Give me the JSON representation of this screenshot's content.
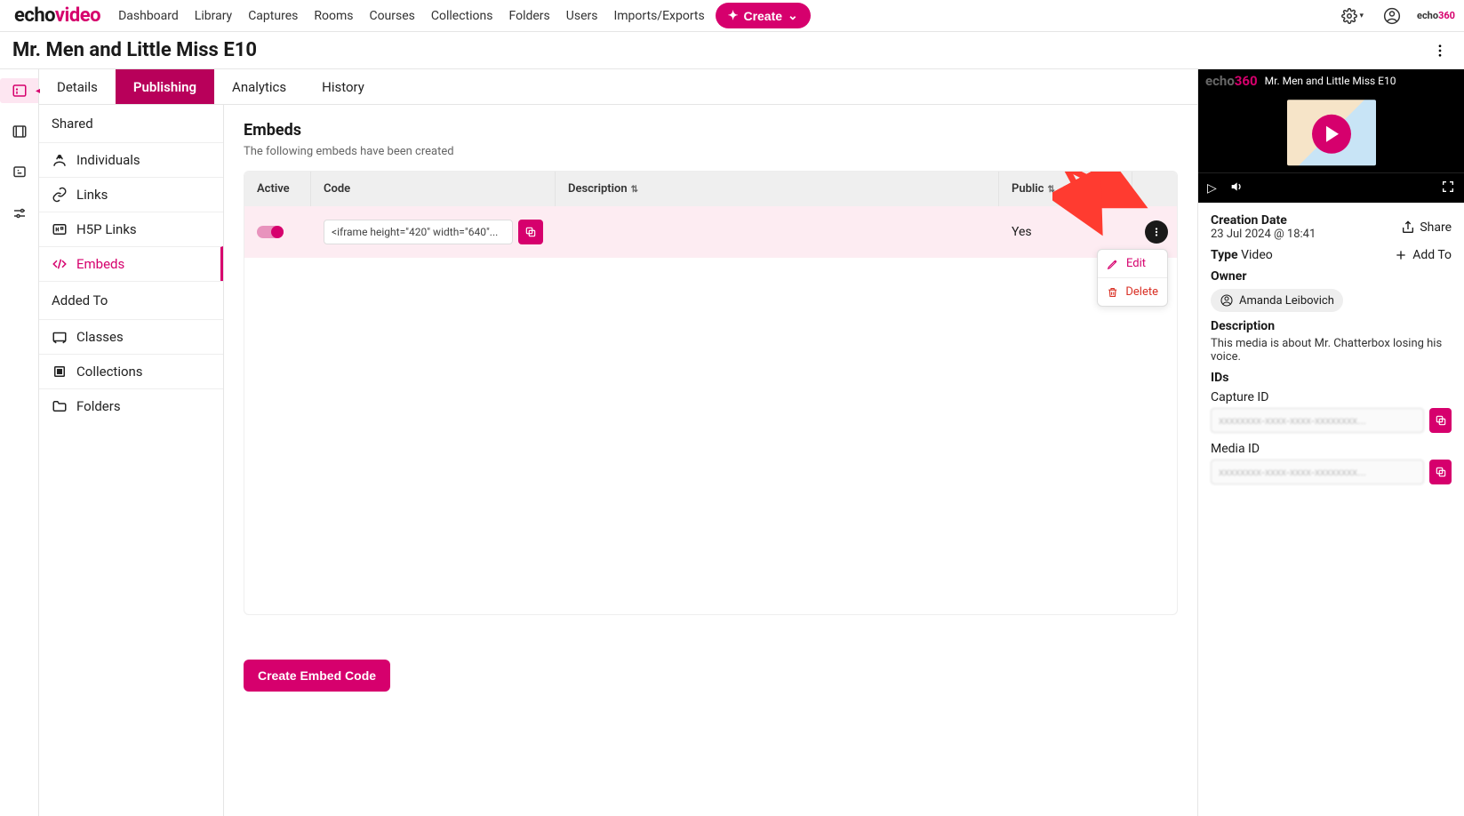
{
  "brand": {
    "part1": "echo",
    "part2": "video"
  },
  "nav": {
    "items": [
      "Dashboard",
      "Library",
      "Captures",
      "Rooms",
      "Courses",
      "Collections",
      "Folders",
      "Users",
      "Imports/Exports"
    ],
    "create": "Create"
  },
  "page": {
    "title": "Mr. Men and Little Miss E10"
  },
  "tabs": [
    "Details",
    "Publishing",
    "Analytics",
    "History"
  ],
  "activeTab": "Publishing",
  "sidemenu": {
    "shared": {
      "title": "Shared",
      "items": [
        "Individuals",
        "Links",
        "H5P Links",
        "Embeds"
      ]
    },
    "added": {
      "title": "Added To",
      "items": [
        "Classes",
        "Collections",
        "Folders"
      ]
    },
    "active": "Embeds"
  },
  "content": {
    "heading": "Embeds",
    "subtitle": "The following embeds have been created",
    "columns": {
      "active": "Active",
      "code": "Code",
      "description": "Description",
      "public": "Public"
    },
    "rows": [
      {
        "active": true,
        "code": "<iframe height=\"420\" width=\"640\"...",
        "description": "",
        "public": "Yes"
      }
    ],
    "dropdown": {
      "edit": "Edit",
      "delete": "Delete"
    },
    "createButton": "Create Embed Code"
  },
  "inspector": {
    "playerTitle": "Mr. Men and Little Miss E10",
    "creationDateLabel": "Creation Date",
    "creationDate": "23 Jul 2024 @ 18:41",
    "shareLabel": "Share",
    "typeLabel": "Type",
    "typeValue": "Video",
    "addToLabel": "Add To",
    "ownerLabel": "Owner",
    "ownerName": "Amanda Leibovich",
    "descriptionLabel": "Description",
    "descriptionText": "This media is about Mr. Chatterbox losing his voice.",
    "idsLabel": "IDs",
    "captureIdLabel": "Capture ID",
    "mediaIdLabel": "Media ID",
    "captureId": "xxxxxxxx-xxxx-xxxx-xxxxxxxx...",
    "mediaId": "xxxxxxxx-xxxx-xxxx-xxxxxxxx..."
  }
}
